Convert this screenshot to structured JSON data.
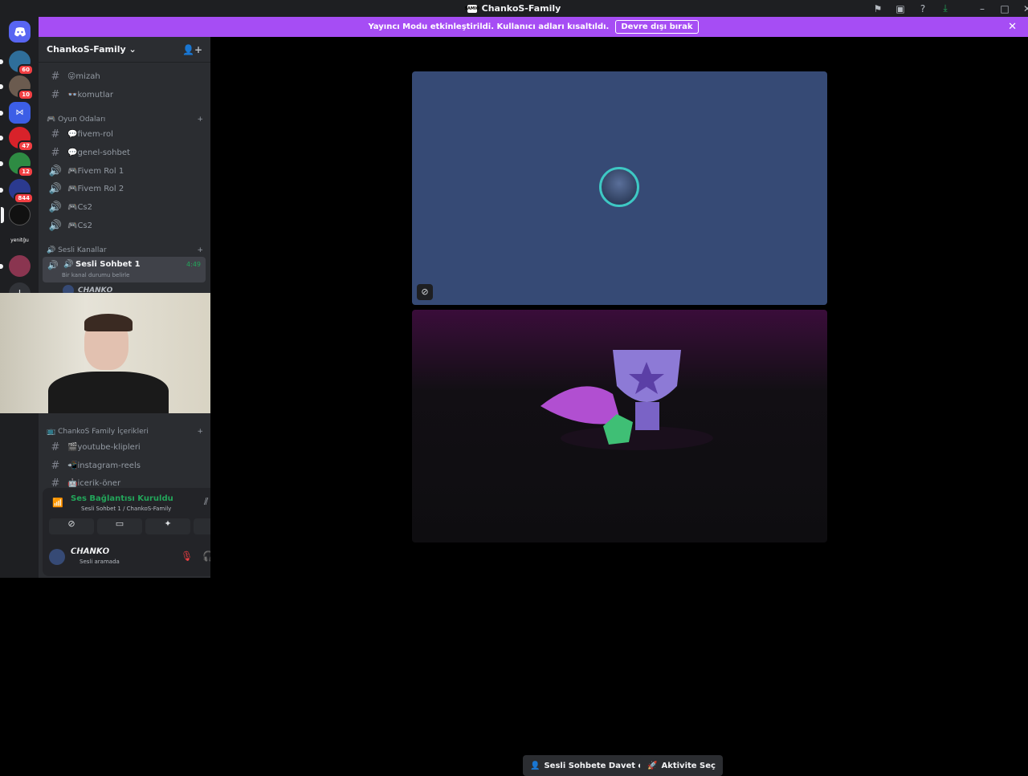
{
  "window": {
    "title": "ChankoS-Family",
    "app_logo": "SAMIO"
  },
  "banner": {
    "text": "Yayıncı Modu etkinleştirildi. Kullanıcı adları kısaltıldı.",
    "button": "Devre dışı bırak"
  },
  "guilds": [
    {
      "name": "discord-home-icon"
    },
    {
      "name": "guild-1",
      "badge": "60"
    },
    {
      "name": "guild-2",
      "badge": "10"
    },
    {
      "name": "guild-3"
    },
    {
      "name": "guild-4",
      "badge": "47"
    },
    {
      "name": "guild-5",
      "badge": "12"
    },
    {
      "name": "guild-6",
      "badge": "844"
    },
    {
      "name": "guild-7"
    },
    {
      "name": "guild-8",
      "label": "yenitğu"
    },
    {
      "name": "guild-9"
    }
  ],
  "server": {
    "name": "ChankoS-Family"
  },
  "channels": {
    "top": [
      {
        "label": "😜mizah"
      },
      {
        "label": "👓komutlar"
      }
    ],
    "cat_games": "🎮 Oyun Odaları",
    "games": [
      {
        "label": "💬fivem-rol",
        "type": "text"
      },
      {
        "label": "💬genel-sohbet",
        "type": "text"
      },
      {
        "label": "🎮Fivem Rol 1",
        "type": "voice"
      },
      {
        "label": "🎮Fivem Rol 2",
        "type": "voice"
      },
      {
        "label": "🎮Cs2",
        "type": "voice"
      },
      {
        "label": "🎮Cs2",
        "type": "voice"
      }
    ],
    "cat_voice": "🔊 Sesli Kanallar",
    "active_voice": {
      "label": "Sesli Sohbet 1",
      "time": "4:49",
      "status": "Bir kanal durumu belirle",
      "member": "𝘾𝙃𝘼𝙉𝙆𝙊"
    },
    "cat_content": "📺 ChankoS Family İçerikleri",
    "content": [
      {
        "label": "🎬youtube-klipleri"
      },
      {
        "label": "📲instagram-reels"
      },
      {
        "label": "🤖icerik-öner"
      }
    ]
  },
  "voice_panel": {
    "status": "Ses Bağlantısı Kuruldu",
    "location": "Sesli Sohbet 1 / ChankoS-Family"
  },
  "user": {
    "name": "𝘾𝙃𝘼𝙉𝙆𝙊",
    "status": "Sesli aramada"
  },
  "main": {
    "invite_button": "Sesli Sohbete Davet et",
    "activity_button": "Aktivite Seç"
  },
  "colors": {
    "accent": "#a64df4",
    "connected": "#23a55a",
    "tile_bg": "#364a75"
  }
}
